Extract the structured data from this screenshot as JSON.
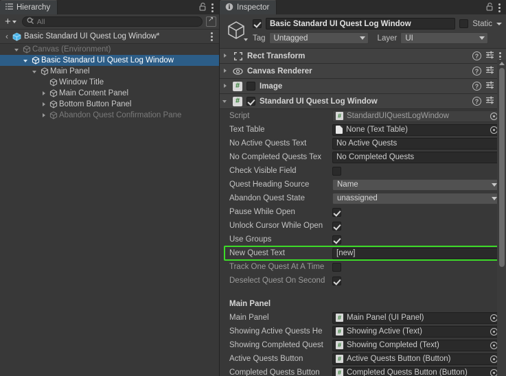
{
  "hierarchy": {
    "tab_label": "Hierarchy",
    "tab_icon": "hierarchy-icon",
    "lock_icon": "lock-open-icon",
    "menu_icon": "kebab-menu-icon",
    "toolbar": {
      "add_label": "+",
      "search_icon": "search-icon",
      "search_value": "",
      "search_placeholder": "All",
      "window_button_icon": "open-window-icon"
    },
    "breadcrumb": {
      "back_icon": "chevron-left-icon",
      "prefab_icon": "prefab-cube-icon",
      "name": "Basic Standard UI Quest Log Window*",
      "menu_icon": "kebab-menu-icon"
    },
    "tree": [
      {
        "label": "Canvas (Environment)",
        "depth": 1,
        "toggle": "down",
        "selected": false,
        "dim": true
      },
      {
        "label": "Basic Standard UI Quest Log Window",
        "depth": 2,
        "toggle": "down",
        "selected": true,
        "dim": false
      },
      {
        "label": "Main Panel",
        "depth": 3,
        "toggle": "down",
        "selected": false,
        "dim": false
      },
      {
        "label": "Window Title",
        "depth": 4,
        "toggle": "none",
        "selected": false,
        "dim": false
      },
      {
        "label": "Main Content Panel",
        "depth": 4,
        "toggle": "right",
        "selected": false,
        "dim": false
      },
      {
        "label": "Bottom Button Panel",
        "depth": 4,
        "toggle": "right",
        "selected": false,
        "dim": false
      },
      {
        "label": "Abandon Quest Confirmation Pane",
        "depth": 4,
        "toggle": "right",
        "selected": false,
        "dim": true
      }
    ]
  },
  "inspector": {
    "tab_label": "Inspector",
    "tab_icon": "info-icon",
    "lock_icon": "lock-open-icon",
    "menu_icon": "kebab-menu-icon",
    "object_header": {
      "icon": "gameobject-cube-icon",
      "active_checked": true,
      "name": "Basic Standard UI Quest Log Window",
      "static_checked": false,
      "static_label": "Static",
      "static_dropdown_icon": "chevron-down-icon",
      "tag_label": "Tag",
      "tag_value": "Untagged",
      "layer_label": "Layer",
      "layer_value": "UI"
    },
    "components": [
      {
        "name": "Rect Transform",
        "icon": "rect-transform-icon",
        "expanded": false,
        "has_enable_checkbox": false,
        "enabled": false
      },
      {
        "name": "Canvas Renderer",
        "icon": "canvas-renderer-eye-icon",
        "expanded": false,
        "has_enable_checkbox": false,
        "enabled": false
      },
      {
        "name": "Image",
        "icon": "script-hash-icon",
        "expanded": false,
        "has_enable_checkbox": true,
        "enabled": false
      },
      {
        "name": "Standard UI Quest Log Window",
        "icon": "script-hash-icon",
        "expanded": true,
        "has_enable_checkbox": true,
        "enabled": true
      }
    ],
    "component_row_icons": {
      "help": "help-icon",
      "preset": "preset-sliders-icon",
      "menu": "kebab-menu-icon"
    },
    "properties": [
      {
        "kind": "object",
        "label": "Script",
        "value": "StandardUIQuestLogWindow",
        "icon": "script-hash-icon",
        "disabled": true,
        "label_dim": true
      },
      {
        "kind": "object",
        "label": "Text Table",
        "value": "None (Text Table)",
        "icon": "document-icon",
        "disabled": false,
        "label_dim": false
      },
      {
        "kind": "text",
        "label": "No Active Quests Text",
        "value": "No Active Quests"
      },
      {
        "kind": "text",
        "label": "No Completed Quests Tex",
        "value": "No Completed Quests"
      },
      {
        "kind": "checkbox",
        "label": "Check Visible Field",
        "checked": false
      },
      {
        "kind": "dropdown",
        "label": "Quest Heading Source",
        "value": "Name"
      },
      {
        "kind": "dropdown",
        "label": "Abandon Quest State",
        "value": "unassigned"
      },
      {
        "kind": "checkbox",
        "label": "Pause While Open",
        "checked": true
      },
      {
        "kind": "checkbox",
        "label": "Unlock Cursor While Open",
        "checked": true
      },
      {
        "kind": "checkbox",
        "label": "Use Groups",
        "checked": true
      },
      {
        "kind": "text",
        "label": "New Quest Text",
        "value": "[new]",
        "highlighted": true
      },
      {
        "kind": "checkbox",
        "label": "Track One Quest At A Time",
        "checked": false,
        "label_dim": true
      },
      {
        "kind": "checkbox",
        "label": "Deselect Quest On Second",
        "checked": true,
        "label_dim": true
      },
      {
        "kind": "spacer"
      },
      {
        "kind": "header",
        "label": "Main Panel"
      },
      {
        "kind": "object",
        "label": "Main Panel",
        "value": "Main Panel (UI Panel)",
        "icon": "script-hash-icon",
        "disabled": false
      },
      {
        "kind": "object",
        "label": "Showing Active Quests He",
        "value": "Showing Active (Text)",
        "icon": "script-hash-icon",
        "disabled": false
      },
      {
        "kind": "object",
        "label": "Showing Completed Quest",
        "value": "Showing Completed (Text)",
        "icon": "script-hash-icon",
        "disabled": false
      },
      {
        "kind": "object",
        "label": "Active Quests Button",
        "value": "Active Quests Button (Button)",
        "icon": "script-hash-icon",
        "disabled": false
      },
      {
        "kind": "object",
        "label": "Completed Quests Button",
        "value": "Completed Quests Button (Button)",
        "icon": "script-hash-icon",
        "disabled": false
      }
    ]
  },
  "colors": {
    "panel_bg": "#383838",
    "header_bg": "#414141",
    "tab_active": "#3c3f41",
    "tabbar_bg": "#2b2b2b",
    "selection_blue": "#2c5d87",
    "highlight_green": "#3ddc28",
    "field_bg": "#2a2a2a",
    "dropdown_bg": "#515151",
    "script_green": "#2f7d32"
  }
}
